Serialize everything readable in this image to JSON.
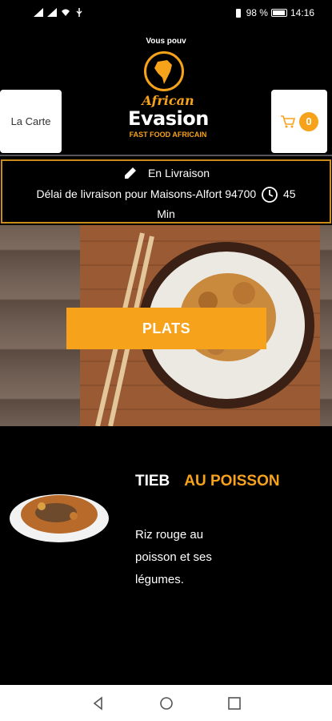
{
  "status_bar": {
    "battery": "98 %",
    "time": "14:16"
  },
  "header": {
    "tagline": "Vous pouv",
    "logo": {
      "script": "African",
      "name": "Evasion",
      "subtitle": "FAST FOOD AFRICAIN"
    },
    "menu_label": "La Carte",
    "cart_count": "0"
  },
  "delivery": {
    "mode": "En Livraison",
    "text_before": "Délai de livraison pour Maisons-Alfort 94700",
    "duration": "45",
    "duration_unit": "Min"
  },
  "hero": {
    "button_label": "PLATS"
  },
  "product": {
    "title_first": "TIEB",
    "title_second": "AU POISSON",
    "description": "Riz rouge au poisson et ses légumes."
  },
  "colors": {
    "accent": "#f7a21b",
    "background": "#000000",
    "border": "#c98b1a"
  }
}
